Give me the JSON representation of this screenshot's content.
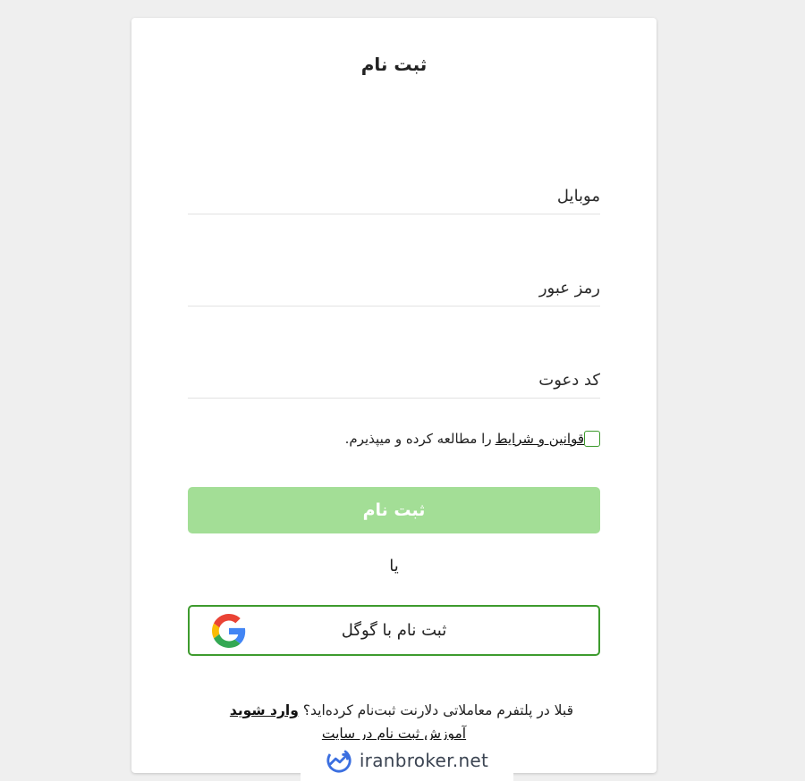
{
  "form": {
    "title": "ثبت نام",
    "mobile_placeholder": "موبایل",
    "password_placeholder": "رمز عبور",
    "invite_placeholder": "کد دعوت",
    "terms_link": "قوانین و شرایط",
    "terms_suffix": " را مطالعه کرده و میپذیرم.",
    "submit_label": "ثبت نام",
    "or_text": "یا",
    "google_label": "ثبت نام با گوگل"
  },
  "footer": {
    "already_text": "قبلا در پلتفرم معاملاتی دلارنت ثبت‌نام کرده‌اید؟ ",
    "login_link": "وارد شوید",
    "tutorial_link": "آموزش ثبت نام در سایت"
  },
  "watermark": {
    "text": "iranbroker.net"
  },
  "colors": {
    "accent_green": "#3e9b2e",
    "submit_disabled": "#a3de96",
    "background": "#efefef"
  },
  "icons": {
    "google": "google-g-icon",
    "watermark": "chart-trend-icon"
  }
}
